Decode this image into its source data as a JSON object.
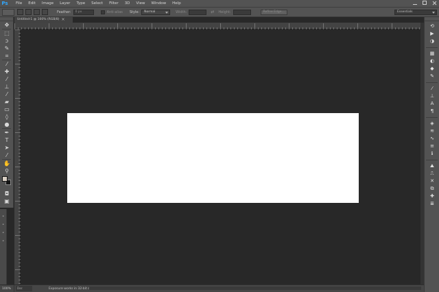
{
  "app": {
    "logo": "Ps"
  },
  "menu": [
    "File",
    "Edit",
    "Image",
    "Layer",
    "Type",
    "Select",
    "Filter",
    "3D",
    "View",
    "Window",
    "Help"
  ],
  "options_bar": {
    "feather_label": "Feather:",
    "feather_value": "0 px",
    "anti_alias_label": "Anti-alias",
    "style_label": "Style:",
    "style_value": "Normal",
    "width_label": "Width:",
    "height_label": "Height:",
    "refine_edge_label": "Refine Edge...",
    "workspace_value": "Essentials"
  },
  "document": {
    "tab_title": "Untitled-1 @ 100% (RGB/8)",
    "close_glyph": "×",
    "canvas_color": "#ffffff"
  },
  "status_bar": {
    "zoom": "100%",
    "doc_info": "Doc",
    "text": "Exposure works in 32-bit only"
  },
  "colors": {
    "foreground": "#d9cfc3",
    "background": "#151515",
    "chrome": "#535353",
    "workspace_bg": "#282828",
    "logo": "#31a8ff"
  },
  "tools": [
    {
      "name": "move-tool",
      "icon": "move-icon",
      "glyph": "✥"
    },
    {
      "name": "marquee-tool",
      "icon": "marquee-icon",
      "glyph": "⬚"
    },
    {
      "name": "lasso-tool",
      "icon": "lasso-icon",
      "glyph": "ↄ"
    },
    {
      "name": "quick-selection-tool",
      "icon": "quick-selection-icon",
      "glyph": "✎"
    },
    {
      "name": "crop-tool",
      "icon": "crop-icon",
      "glyph": "⌗"
    },
    {
      "name": "eyedropper-tool",
      "icon": "eyedropper-icon",
      "glyph": "⁄"
    },
    {
      "name": "healing-brush-tool",
      "icon": "bandage-icon",
      "glyph": "✚"
    },
    {
      "name": "brush-tool",
      "icon": "brush-icon",
      "glyph": "⁄"
    },
    {
      "name": "clone-stamp-tool",
      "icon": "stamp-icon",
      "glyph": "⊥"
    },
    {
      "name": "history-brush-tool",
      "icon": "history-brush-icon",
      "glyph": "⁄"
    },
    {
      "name": "eraser-tool",
      "icon": "eraser-icon",
      "glyph": "▰"
    },
    {
      "name": "gradient-tool",
      "icon": "gradient-icon",
      "glyph": "▭"
    },
    {
      "name": "blur-tool",
      "icon": "drop-icon",
      "glyph": "◊"
    },
    {
      "name": "dodge-tool",
      "icon": "dodge-icon",
      "glyph": "●"
    },
    {
      "name": "pen-tool",
      "icon": "pen-icon",
      "glyph": "✒"
    },
    {
      "name": "type-tool",
      "icon": "type-icon",
      "glyph": "T"
    },
    {
      "name": "path-selection-tool",
      "icon": "arrow-icon",
      "glyph": "➤"
    },
    {
      "name": "shape-tool",
      "icon": "line-icon",
      "glyph": "⁄"
    },
    {
      "name": "hand-tool",
      "icon": "hand-icon",
      "glyph": "✋"
    },
    {
      "name": "zoom-tool",
      "icon": "zoom-icon",
      "glyph": "⚲"
    }
  ],
  "panels": [
    {
      "name": "history-panel-button",
      "icon": "history-icon",
      "glyph": "⟲"
    },
    {
      "name": "actions-panel-button",
      "icon": "actions-icon",
      "glyph": "▶"
    },
    {
      "name": "color-panel-button",
      "icon": "color-icon",
      "glyph": "◑"
    },
    {
      "name": "swatches-panel-button",
      "icon": "swatches-icon",
      "glyph": "▦"
    },
    {
      "name": "adjustments-panel-button",
      "icon": "adjustments-icon",
      "glyph": "◐"
    },
    {
      "name": "styles-panel-button",
      "icon": "styles-icon",
      "glyph": "◆"
    },
    {
      "name": "brush-panel-button",
      "icon": "brush-panel-icon",
      "glyph": "✎"
    },
    {
      "name": "brush-presets-panel-button",
      "icon": "brush-presets-icon",
      "glyph": "⁄"
    },
    {
      "name": "clone-source-panel-button",
      "icon": "clone-source-icon",
      "glyph": "⊥"
    },
    {
      "name": "character-panel-button",
      "icon": "character-icon",
      "glyph": "A"
    },
    {
      "name": "paragraph-panel-button",
      "icon": "paragraph-icon",
      "glyph": "¶"
    },
    {
      "name": "layers-panel-button",
      "icon": "layers-icon",
      "glyph": "◈"
    },
    {
      "name": "channels-panel-button",
      "icon": "channels-icon",
      "glyph": "≋"
    },
    {
      "name": "paths-panel-button",
      "icon": "paths-icon",
      "glyph": "∿"
    },
    {
      "name": "properties-panel-button",
      "icon": "properties-icon",
      "glyph": "≡"
    },
    {
      "name": "info-panel-button",
      "icon": "info-icon",
      "glyph": "ℹ"
    },
    {
      "name": "navigator-panel-button",
      "icon": "navigator-icon",
      "glyph": "⛰"
    },
    {
      "name": "timeline-panel-button",
      "icon": "timeline-icon",
      "glyph": "⎍"
    },
    {
      "name": "tool-presets-panel-button",
      "icon": "tool-presets-icon",
      "glyph": "✕"
    },
    {
      "name": "layer-comps-panel-button",
      "icon": "layer-comps-icon",
      "glyph": "⧉"
    },
    {
      "name": "notes-panel-button",
      "icon": "notes-icon",
      "glyph": "✚"
    },
    {
      "name": "measurement-panel-button",
      "icon": "measurement-icon",
      "glyph": "≣"
    }
  ]
}
